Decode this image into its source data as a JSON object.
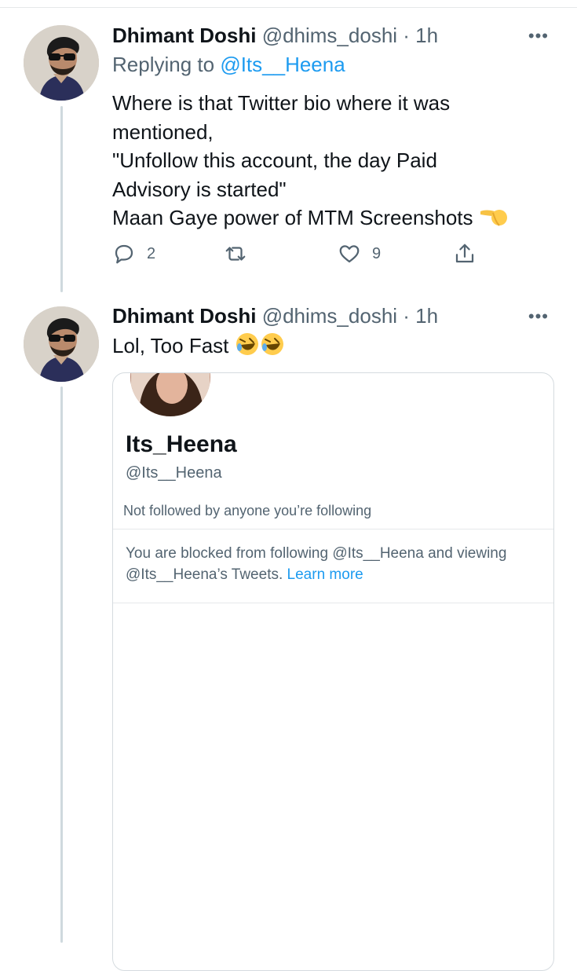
{
  "tweets": [
    {
      "name": "Dhimant Doshi",
      "handle": "@dhims_doshi",
      "time": "· 1h",
      "reply_prefix": "Replying to",
      "reply_mention": "@Its__Heena",
      "text_lines": [
        "Where is that Twitter bio where it was",
        "mentioned,",
        "\"Unfollow this account, the day Paid",
        "Advisory is started\"",
        "Maan Gaye power of MTM Screenshots"
      ],
      "trailing_emoji": "backhand-index-pointing-left",
      "actions": {
        "reply_count": "2",
        "retweet_count": "",
        "like_count": "9"
      }
    },
    {
      "name": "Dhimant Doshi",
      "handle": "@dhims_doshi",
      "time": "· 1h",
      "text": "Lol, Too Fast",
      "emojis": [
        "rolling-on-floor-laughing",
        "rolling-on-floor-laughing"
      ]
    }
  ],
  "quoted_profile": {
    "name": "Its_Heena",
    "handle": "@Its__Heena",
    "followed_note": "Not followed by anyone you’re following",
    "blocked_text": "You are blocked from following @Its__Heena and viewing @Its__Heena’s Tweets.",
    "learn_more": "Learn more"
  },
  "colors": {
    "link": "#1d9bf0",
    "secondary": "#536471",
    "primary": "#0f1419",
    "thread_line": "#cfd9de"
  }
}
